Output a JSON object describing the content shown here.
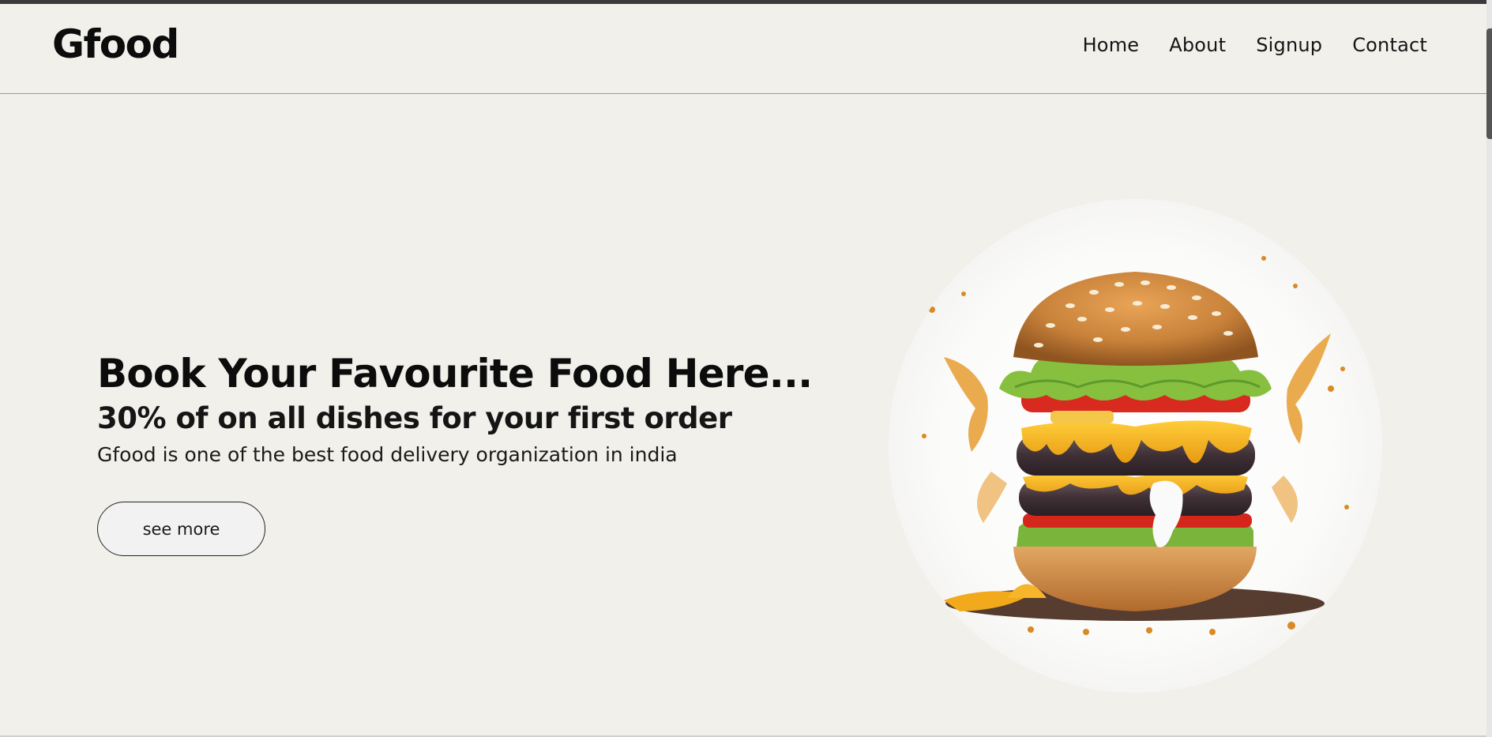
{
  "brand": {
    "logo": "Gfood"
  },
  "nav": {
    "items": [
      {
        "label": "Home"
      },
      {
        "label": "About"
      },
      {
        "label": "Signup"
      },
      {
        "label": "Contact"
      }
    ]
  },
  "hero": {
    "title": "Book Your Favourite Food Here...",
    "subtitle": "30% of on all dishes for your first order",
    "description": "Gfood is one of the best food delivery organization in india",
    "cta_label": "see more"
  },
  "colors": {
    "background": "#f1f0eb",
    "text": "#111111",
    "accent_bun": "#c9823a",
    "accent_cheese": "#f2b320"
  },
  "image": {
    "subject": "burger-image"
  }
}
